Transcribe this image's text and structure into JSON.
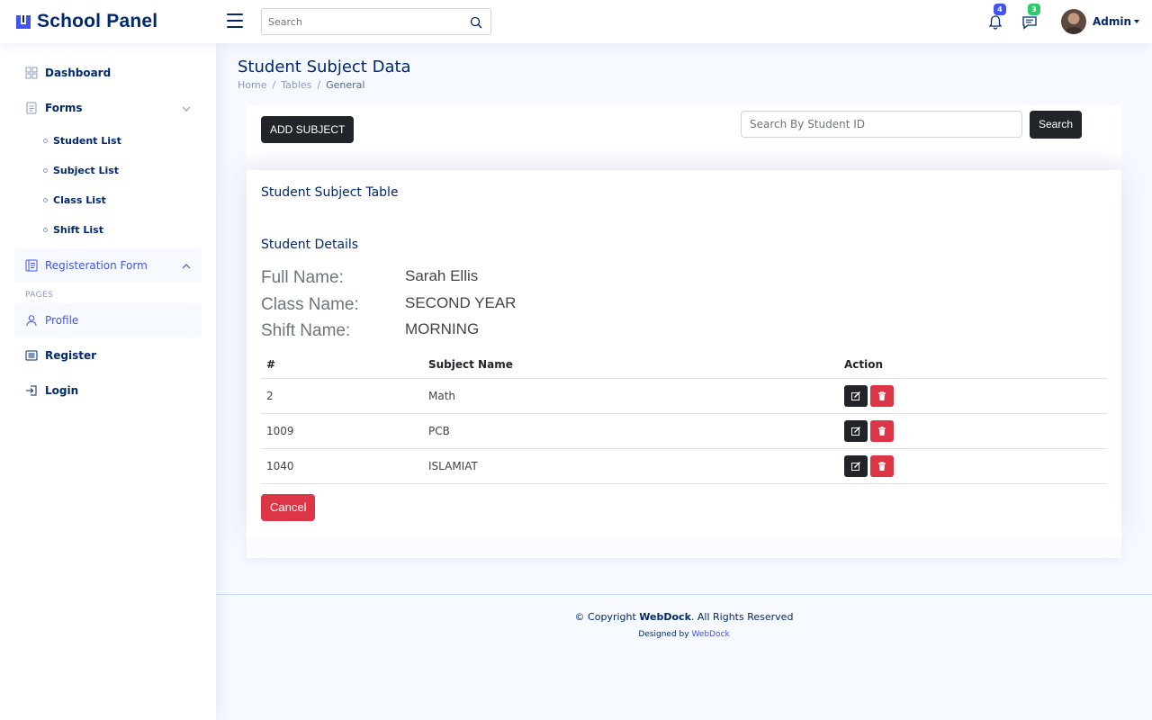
{
  "brand": {
    "name": "School Panel"
  },
  "header": {
    "search_placeholder": "Search",
    "notifications_count": "4",
    "messages_count": "3",
    "user_name": "Admin"
  },
  "sidebar": {
    "dashboard": "Dashboard",
    "forms": "Forms",
    "sub_items": [
      "Student List",
      "Subject List",
      "Class List",
      "Shift List"
    ],
    "registration": "Registeration Form",
    "pages_heading": "PAGES",
    "profile": "Profile",
    "register": "Register",
    "login": "Login"
  },
  "page": {
    "title": "Student Subject Data",
    "breadcrumb": [
      "Home",
      "Tables",
      "General"
    ]
  },
  "toolbar": {
    "add_subject": "ADD SUBJECT",
    "student_id_placeholder": "Search By Student ID",
    "search_button": "Search"
  },
  "card": {
    "title": "Student Subject Table",
    "details_title": "Student Details",
    "details": [
      {
        "label": "Full Name:",
        "value": "Sarah Ellis"
      },
      {
        "label": "Class Name:",
        "value": "SECOND YEAR"
      },
      {
        "label": "Shift Name:",
        "value": "MORNING"
      }
    ],
    "table": {
      "headers": [
        "#",
        "Subject Name",
        "Action"
      ],
      "rows": [
        {
          "id": "2",
          "subject": "Math"
        },
        {
          "id": "1009",
          "subject": "PCB"
        },
        {
          "id": "1040",
          "subject": "ISLAMIAT"
        }
      ]
    },
    "cancel": "Cancel"
  },
  "footer": {
    "copyright_prefix": "© Copyright ",
    "company": "WebDock",
    "copyright_suffix": ". All Rights Reserved",
    "designed_by": "Designed by ",
    "designer": "WebDock"
  },
  "colors": {
    "primary_navy": "#012970",
    "accent_blue": "#4154f1",
    "dark_button": "#212529",
    "danger": "#dc3545",
    "success_badge": "#2eca6a"
  }
}
